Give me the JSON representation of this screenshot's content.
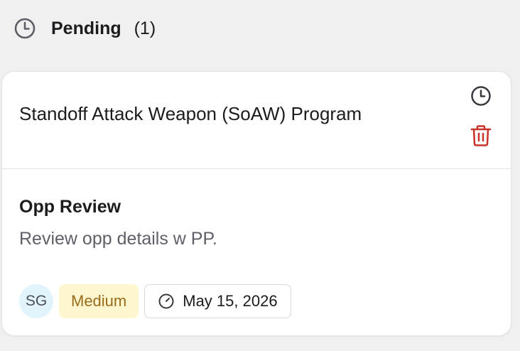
{
  "header": {
    "title": "Pending",
    "count": "(1)",
    "icon": "clock-icon"
  },
  "card": {
    "opportunity_title": "Standoff Attack Weapon (SoAW) Program",
    "actions": {
      "snooze_icon": "clock-icon",
      "delete_icon": "trash-icon",
      "delete_color": "#c8342b"
    },
    "task": {
      "title": "Opp Review",
      "description": "Review opp details w PP."
    },
    "meta": {
      "assignee_initials": "SG",
      "priority": "Medium",
      "due_date": "May 15, 2026",
      "due_icon": "timer-icon"
    }
  },
  "colors": {
    "background": "#f0f0f1",
    "card": "#ffffff",
    "priority_bg": "#fdf6cf",
    "priority_text": "#9a6d1d",
    "avatar_bg": "#e2f4fb"
  }
}
